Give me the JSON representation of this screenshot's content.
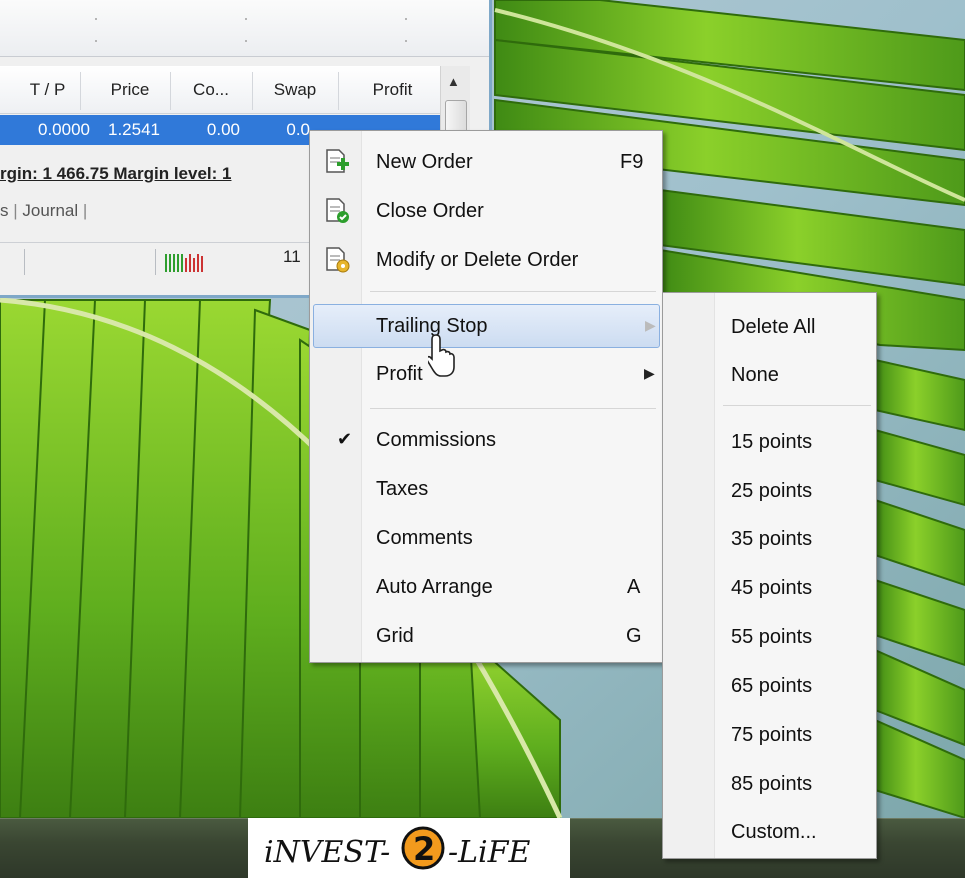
{
  "terminal": {
    "columns": [
      "T / P",
      "Price",
      "Co...",
      "Swap",
      "Profit"
    ],
    "row": {
      "tp": "0.0000",
      "price": "1.2541",
      "commission": "0.00",
      "swap": "0.0"
    },
    "margin_text": "rgin: 1 466.75  Margin level: 1",
    "tabs": [
      "s",
      "Journal"
    ],
    "status_value": "11"
  },
  "context_menu": {
    "items": [
      {
        "label": "New Order",
        "accel": "F9",
        "icon": "new-order-icon"
      },
      {
        "label": "Close Order",
        "icon": "close-order-icon"
      },
      {
        "label": "Modify or Delete Order",
        "icon": "modify-order-icon"
      },
      {
        "label": "Trailing Stop",
        "submenu": true,
        "highlighted": true
      },
      {
        "label": "Profit",
        "submenu": true
      },
      {
        "label": "Commissions",
        "checked": true
      },
      {
        "label": "Taxes"
      },
      {
        "label": "Comments"
      },
      {
        "label": "Auto Arrange",
        "accel": "A"
      },
      {
        "label": "Grid",
        "accel": "G"
      }
    ],
    "check_mark": "✔",
    "submenu_arrow": "▶"
  },
  "trailing_stop_submenu": {
    "items": [
      "Delete All",
      "None",
      "15 points",
      "25 points",
      "35 points",
      "45 points",
      "55 points",
      "65 points",
      "75 points",
      "85 points",
      "Custom..."
    ]
  },
  "watermark": {
    "brand": "INVEST-2-LIFE",
    "left": "iNVEST-",
    "middle": "2",
    "right": "-LiFE"
  },
  "colors": {
    "selection": "#3079d9",
    "menu_hover": "#ccdcf1",
    "logo_orange": "#f39a1d"
  }
}
